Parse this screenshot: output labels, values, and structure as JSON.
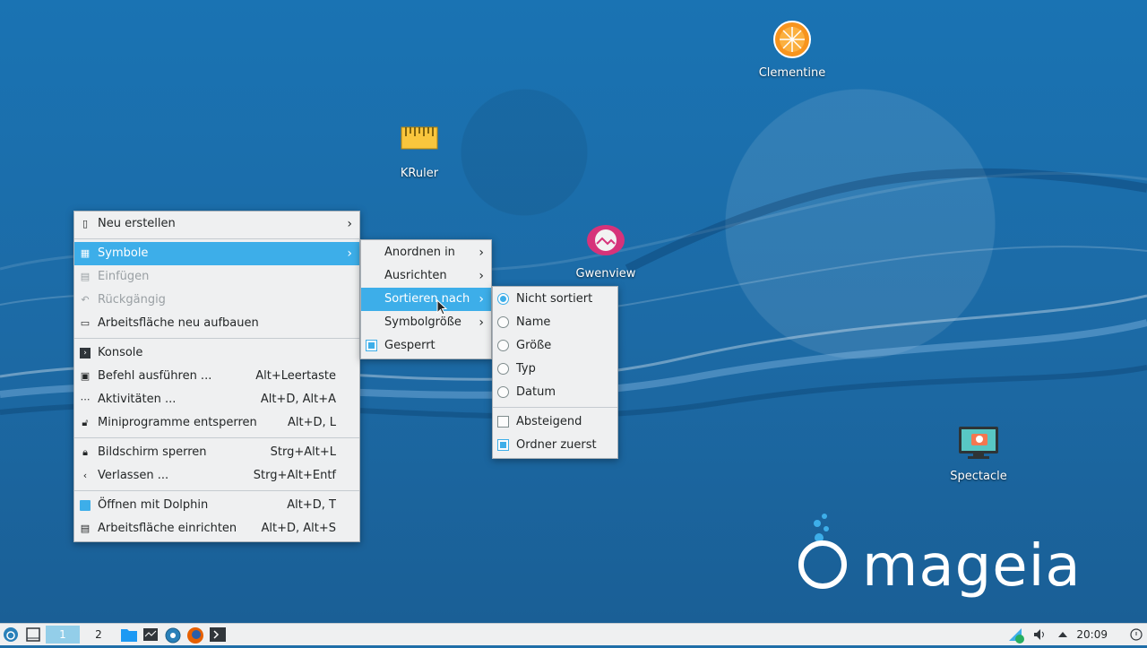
{
  "desktop": {
    "icons": [
      {
        "label": "Clementine"
      },
      {
        "label": "KRuler"
      },
      {
        "label": "Gwenview"
      },
      {
        "label": "Spectacle"
      }
    ],
    "logo_text": "mageia"
  },
  "context_menu": {
    "items": [
      {
        "label": "Neu erstellen",
        "shortcut": ""
      },
      {
        "label": "Symbole",
        "shortcut": ""
      },
      {
        "label": "Einfügen",
        "shortcut": ""
      },
      {
        "label": "Rückgängig",
        "shortcut": ""
      },
      {
        "label": "Arbeitsfläche neu aufbauen",
        "shortcut": ""
      },
      {
        "label": "Konsole",
        "shortcut": ""
      },
      {
        "label": "Befehl ausführen ...",
        "shortcut": "Alt+Leertaste"
      },
      {
        "label": "Aktivitäten ...",
        "shortcut": "Alt+D, Alt+A"
      },
      {
        "label": "Miniprogramme entsperren",
        "shortcut": "Alt+D, L"
      },
      {
        "label": "Bildschirm sperren",
        "shortcut": "Strg+Alt+L"
      },
      {
        "label": "Verlassen ...",
        "shortcut": "Strg+Alt+Entf"
      },
      {
        "label": "Öffnen mit Dolphin",
        "shortcut": "Alt+D, T"
      },
      {
        "label": "Arbeitsfläche einrichten",
        "shortcut": "Alt+D, Alt+S"
      }
    ]
  },
  "symbole_menu": {
    "items": [
      {
        "label": "Anordnen in"
      },
      {
        "label": "Ausrichten"
      },
      {
        "label": "Sortieren nach"
      },
      {
        "label": "Symbolgröße"
      },
      {
        "label": "Gesperrt",
        "checked": true
      }
    ]
  },
  "sort_menu": {
    "items": [
      {
        "label": "Nicht sortiert",
        "selected": true
      },
      {
        "label": "Name",
        "selected": false
      },
      {
        "label": "Größe",
        "selected": false
      },
      {
        "label": "Typ",
        "selected": false
      },
      {
        "label": "Datum",
        "selected": false
      },
      {
        "label": "Absteigend",
        "checked": false
      },
      {
        "label": "Ordner zuerst",
        "checked": true
      }
    ]
  },
  "taskbar": {
    "desktops": [
      "1",
      "2"
    ],
    "active_desktop": "1",
    "clock": "20:09"
  },
  "colors": {
    "highlight": "#3daee9",
    "desktop_bg": "#1a6ea8",
    "menu_bg": "#eff0f1"
  }
}
